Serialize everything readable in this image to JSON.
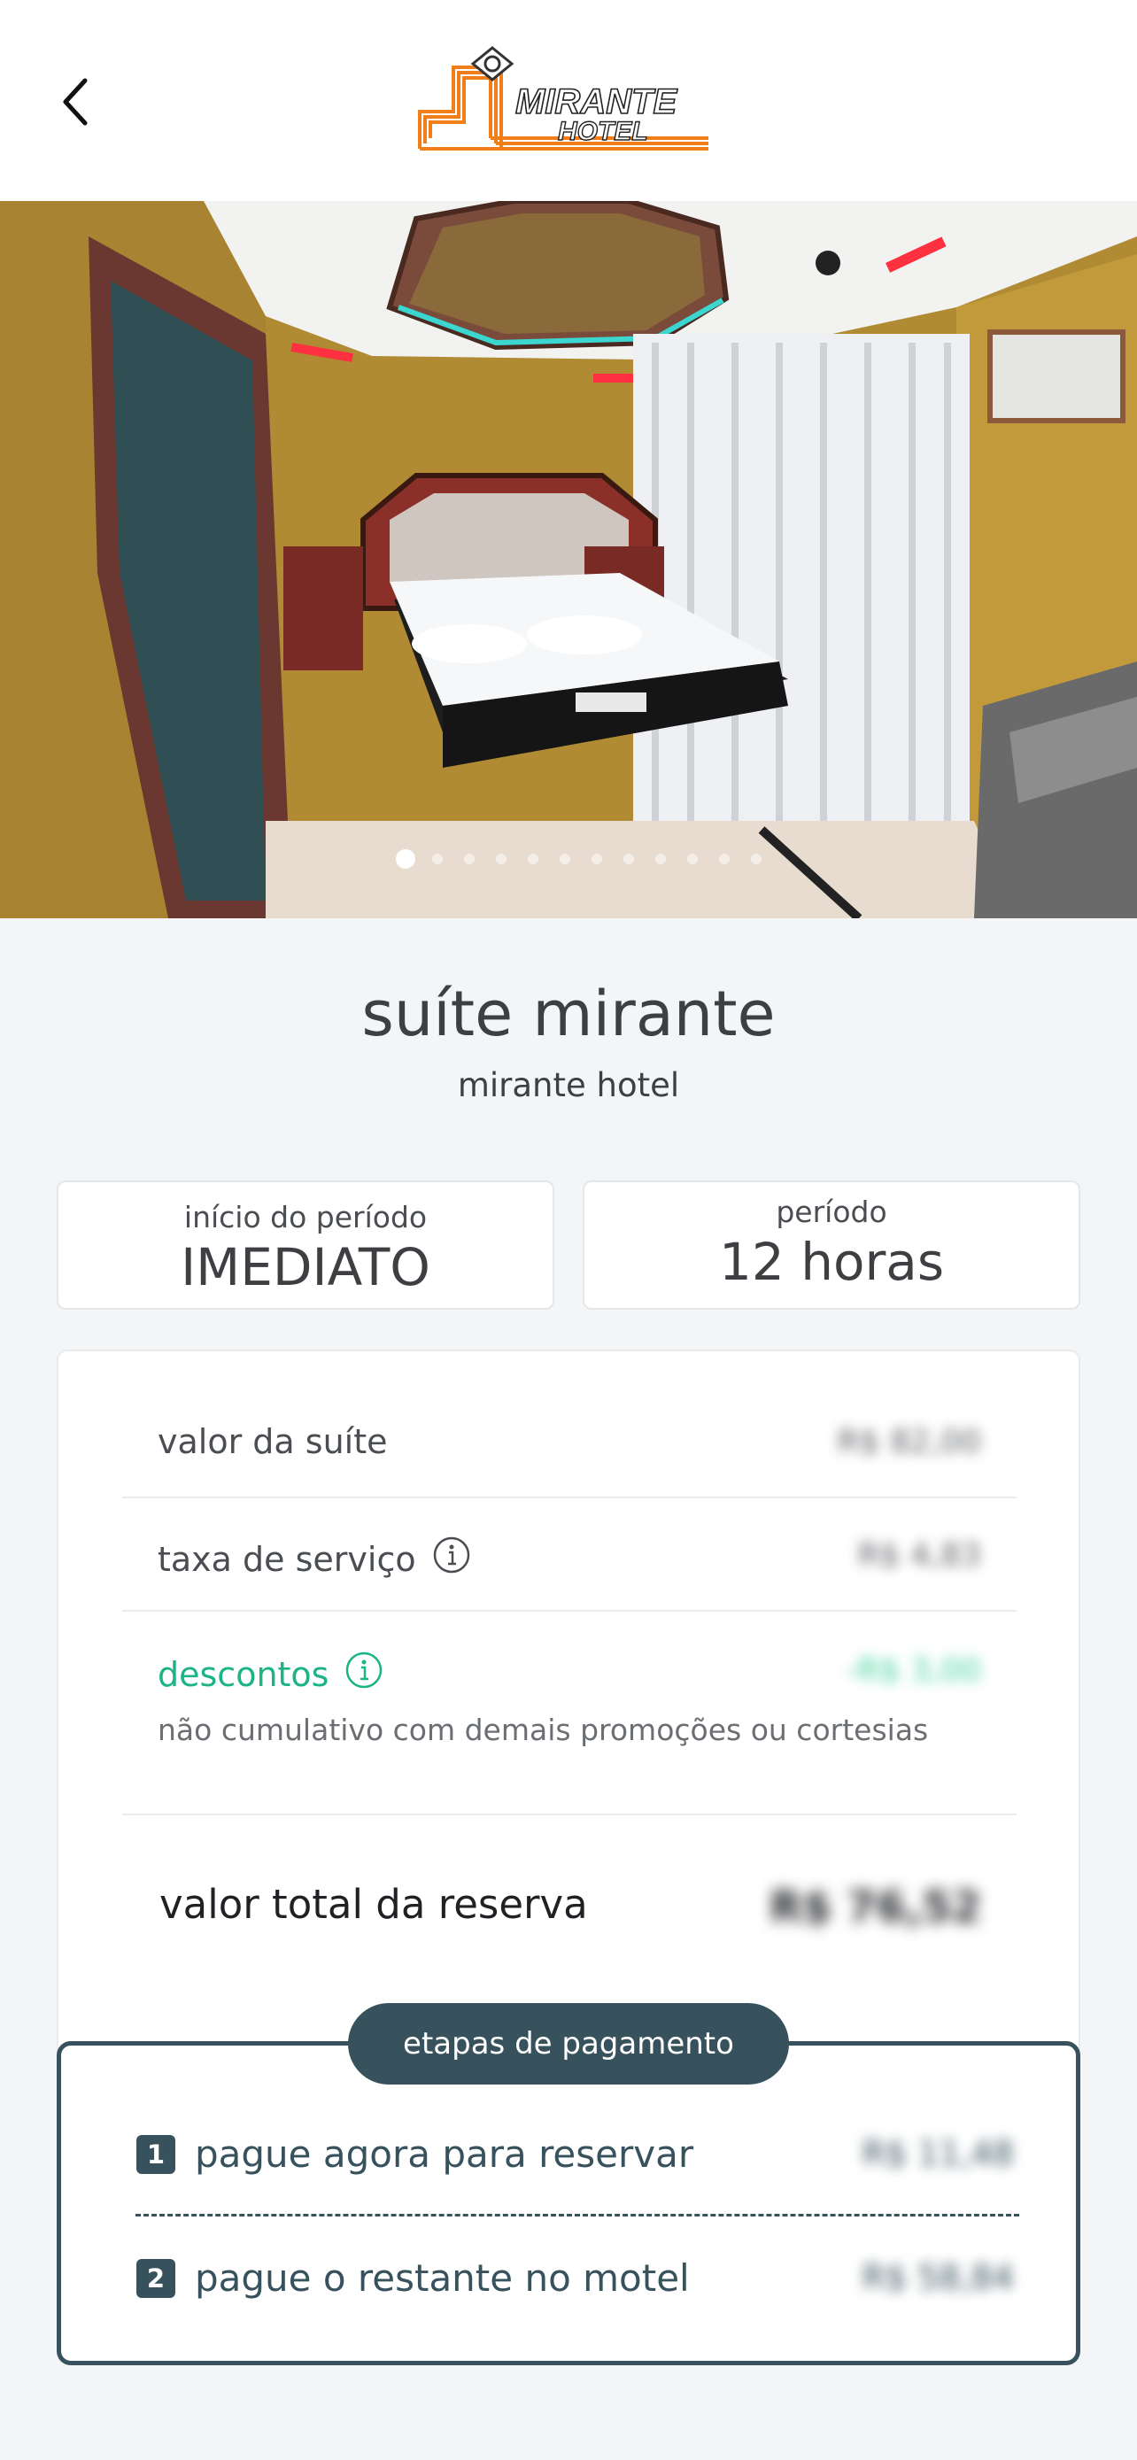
{
  "header": {
    "back_icon": "chevron-left-icon",
    "logo": {
      "line1": "MIRANTE",
      "line2": "HOTEL",
      "brand_color": "#f07f1a"
    }
  },
  "gallery": {
    "total_images": 12,
    "active_index": 0
  },
  "suite": {
    "name": "suíte mirante",
    "hotel": "mirante hotel"
  },
  "booking": {
    "start_label": "início do período",
    "start_value": "IMEDIATO",
    "period_label": "período",
    "period_value": "12 horas"
  },
  "pricing": {
    "suite_label": "valor da suíte",
    "suite_value": "R$ 82,00",
    "service_label": "taxa de serviço",
    "service_value": "R$ 4,83",
    "discount_label": "descontos",
    "discount_value": "-R$ 3,00",
    "discount_note": "não cumulativo com demais promoções ou cortesias",
    "total_label": "valor total da reserva",
    "total_value": "R$ 76,52"
  },
  "payment": {
    "title": "etapas de pagamento",
    "steps": [
      {
        "num": "1",
        "label": "pague agora para reservar",
        "value": "R$ 11,48"
      },
      {
        "num": "2",
        "label": "pague o restante no motel",
        "value": "R$ 58,84"
      }
    ]
  },
  "colors": {
    "accent_green": "#1cb386",
    "dark_teal": "#37525c",
    "logo_orange": "#f07f1a"
  }
}
